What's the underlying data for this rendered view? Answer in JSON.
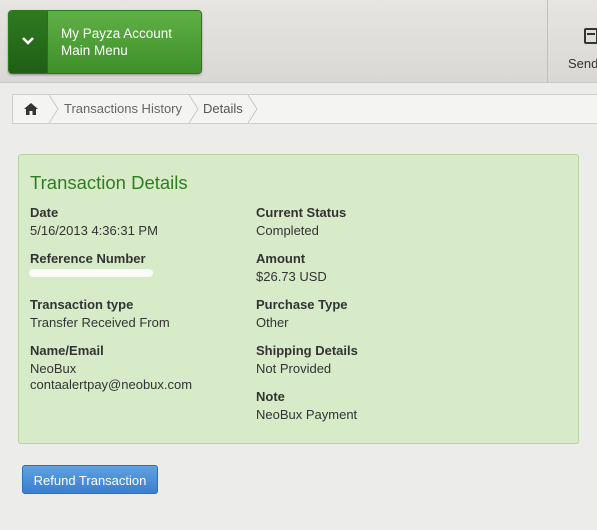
{
  "header": {
    "menu": {
      "line1": "My Payza Account",
      "line2": "Main Menu"
    },
    "send_label": "Send"
  },
  "breadcrumb": {
    "items": [
      "Transactions History",
      "Details"
    ]
  },
  "details": {
    "title": "Transaction Details",
    "left": [
      {
        "label": "Date",
        "value": "5/16/2013 4:36:31 PM"
      },
      {
        "label": "Reference Number",
        "value": ""
      },
      {
        "label": "Transaction type",
        "value": "Transfer Received From"
      },
      {
        "label": "Name/Email",
        "value": "NeoBux",
        "value2": "contaalertpay@neobux.com"
      }
    ],
    "right": [
      {
        "label": "Current Status",
        "value": "Completed"
      },
      {
        "label": "Amount",
        "value": "$26.73 USD"
      },
      {
        "label": "Purchase Type",
        "value": "Other"
      },
      {
        "label": "Shipping Details",
        "value": "Not Provided"
      },
      {
        "label": "Note",
        "value": "NeoBux Payment"
      }
    ]
  },
  "actions": {
    "refund_label": "Refund Transaction"
  }
}
